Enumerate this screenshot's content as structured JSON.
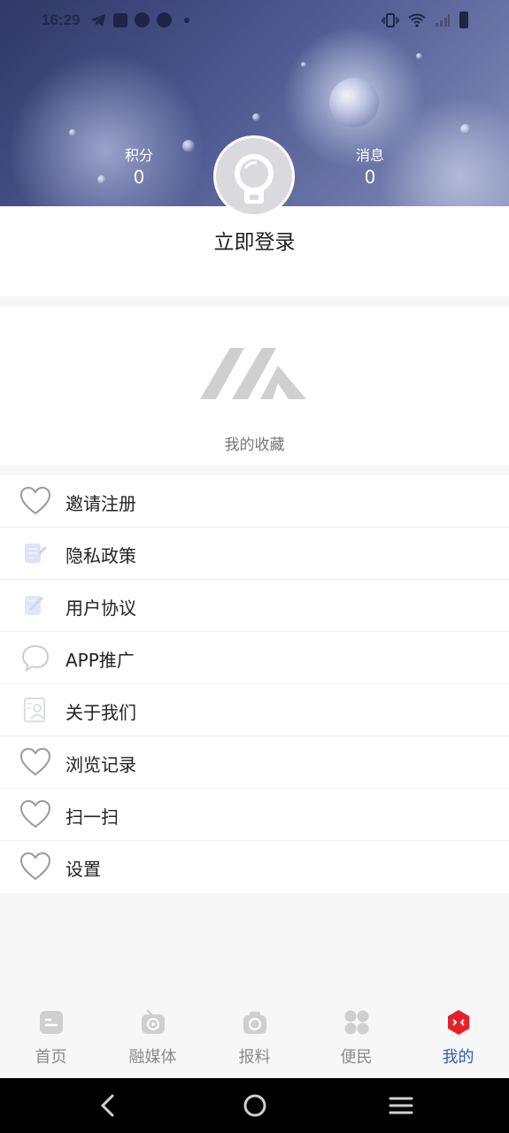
{
  "status_bar": {
    "time": "16:29"
  },
  "stats": {
    "points_label": "积分",
    "points_value": "0",
    "messages_label": "消息",
    "messages_value": "0"
  },
  "profile": {
    "login_text": "立即登录"
  },
  "favorites": {
    "label": "我的收藏"
  },
  "menu": {
    "items": [
      {
        "label": "邀请注册",
        "icon": "heart-icon"
      },
      {
        "label": "隐私政策",
        "icon": "document-icon"
      },
      {
        "label": "用户协议",
        "icon": "edit-document-icon"
      },
      {
        "label": "APP推广",
        "icon": "chat-bubble-icon"
      },
      {
        "label": "关于我们",
        "icon": "contact-card-icon"
      },
      {
        "label": "浏览记录",
        "icon": "heart-icon"
      },
      {
        "label": "扫一扫",
        "icon": "heart-icon"
      },
      {
        "label": "设置",
        "icon": "heart-icon"
      }
    ]
  },
  "tabs": [
    {
      "label": "首页",
      "icon": "home-icon"
    },
    {
      "label": "融媒体",
      "icon": "media-play-icon"
    },
    {
      "label": "报料",
      "icon": "camera-icon"
    },
    {
      "label": "便民",
      "icon": "grid-clover-icon"
    },
    {
      "label": "我的",
      "icon": "profile-hex-icon",
      "active": true
    }
  ],
  "colors": {
    "active_tab": "#2b5fb0",
    "inactive_tab": "#8a8a8a",
    "profile_icon": "#e8202a"
  }
}
